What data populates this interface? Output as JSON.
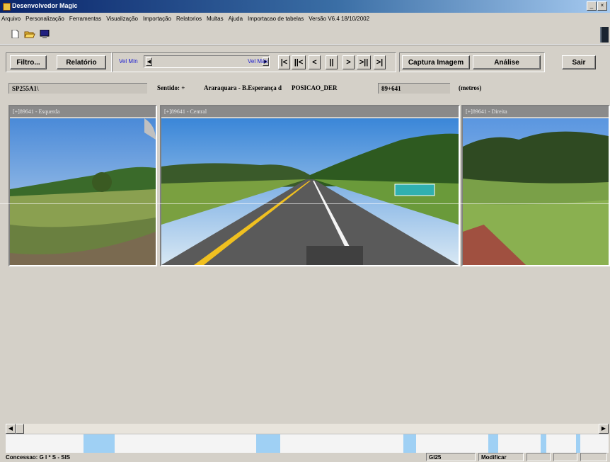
{
  "window": {
    "title": "Desenvolvedor Magic",
    "controls": [
      "_",
      "×"
    ]
  },
  "menu": [
    "Arquivo",
    "Personalização",
    "Ferramentas",
    "Visualização",
    "Importação",
    "Relatorios",
    "Multas",
    "Ajuda",
    "Importacao de tabelas",
    "Versão V6.4 18/10/2002"
  ],
  "toolbar": {
    "icons": [
      "new-document-icon",
      "open-folder-icon",
      "monitor-icon"
    ]
  },
  "controls": {
    "filtro": "Filtro...",
    "relatorio": "Relatório",
    "vel_min": "Vel Mín",
    "vel_max": "Vel Máx",
    "speed_level": 1.0,
    "nav": [
      "|<",
      "||<",
      "<",
      "||",
      ">",
      ">||",
      ">|"
    ],
    "captura": "Captura Imagem",
    "analise": "Análise",
    "sair": "Sair"
  },
  "info": {
    "rodovia": "SP255A1\\",
    "sentido_label": "Sentido: +",
    "sentido_value": "Araraquara - B.Esperança d",
    "posicao_label": "POSICAO_DER",
    "posicao_value": "89+641",
    "unidade": "(metros)"
  },
  "panels": [
    {
      "title": "[+]89641 - Esquerda"
    },
    {
      "title": "[+]89641 - Central"
    },
    {
      "title": "[+]89641 - Direita"
    }
  ],
  "status": {
    "concessao": "Concessao: G I * S - SIS",
    "code": "GI25",
    "action": "Modificar"
  },
  "colors": {
    "title_start": "#0a246a",
    "title_end": "#a6caf0",
    "vel_label": "#2020d0",
    "timeline_mark": "#9fd0f4"
  }
}
